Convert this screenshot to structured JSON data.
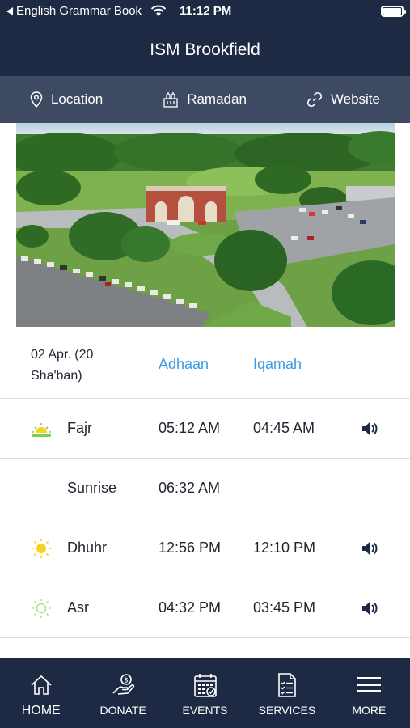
{
  "status_bar": {
    "back_label": "English Grammar Book",
    "time": "11:12 PM"
  },
  "header": {
    "title": "ISM Brookfield"
  },
  "info_bar": {
    "items": [
      {
        "label": "Location",
        "icon": "location-pin-icon"
      },
      {
        "label": "Ramadan",
        "icon": "ramadan-icon"
      },
      {
        "label": "Website",
        "icon": "link-icon"
      }
    ]
  },
  "hero": {
    "image": "aerial-mosque-photo"
  },
  "prayer_table": {
    "date_line1": "02 Apr. (20",
    "date_line2": "Sha'ban)",
    "adhaan_header": "Adhaan",
    "iqamah_header": "Iqamah",
    "colors": {
      "header_accent": "#3a9ae3",
      "sun_yellow": "#f5d320",
      "horizon_green": "#7ccf4a"
    },
    "rows": [
      {
        "name": "Fajr",
        "adhaan": "05:12 AM",
        "iqamah": "04:45 AM",
        "icon": "sunrise-icon",
        "sound": true
      },
      {
        "name": "Sunrise",
        "adhaan": "06:32 AM",
        "iqamah": "",
        "icon": "",
        "sound": false
      },
      {
        "name": "Dhuhr",
        "adhaan": "12:56 PM",
        "iqamah": "12:10 PM",
        "icon": "sun-icon",
        "sound": true
      },
      {
        "name": "Asr",
        "adhaan": "04:32 PM",
        "iqamah": "03:45 PM",
        "icon": "sun-outline-icon",
        "sound": true
      }
    ]
  },
  "tab_bar": {
    "tabs": [
      {
        "label": "HOME",
        "icon": "home-icon",
        "active": true
      },
      {
        "label": "DONATE",
        "icon": "donate-icon",
        "active": false
      },
      {
        "label": "EVENTS",
        "icon": "calendar-icon",
        "active": false
      },
      {
        "label": "SERVICES",
        "icon": "clipboard-icon",
        "active": false
      },
      {
        "label": "MORE",
        "icon": "menu-icon",
        "active": false
      }
    ]
  },
  "brand_colors": {
    "navy": "#1e2a44",
    "slate": "#3d4a62"
  }
}
